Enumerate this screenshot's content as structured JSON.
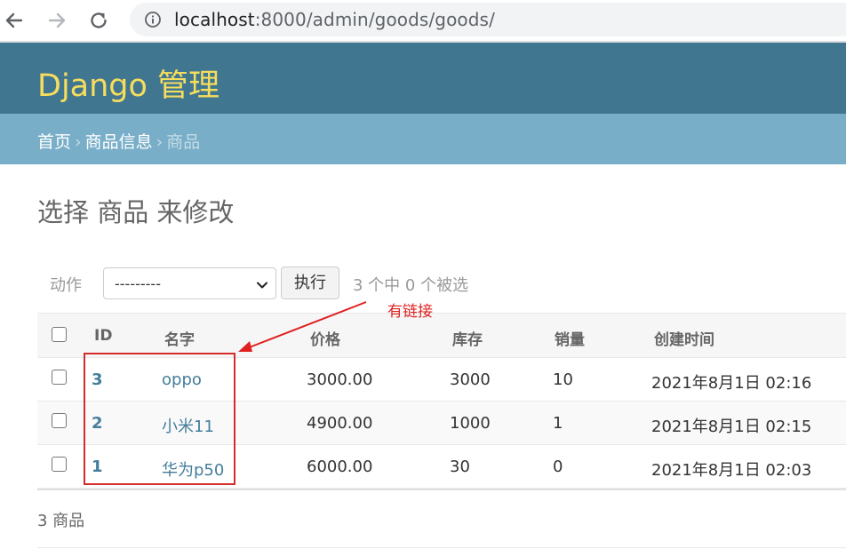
{
  "browser": {
    "url_host": "localhost",
    "url_rest": ":8000/admin/goods/goods/"
  },
  "header": {
    "branding": "Django 管理"
  },
  "breadcrumbs": {
    "home": "首页",
    "sep": "›",
    "app": "商品信息",
    "current": "商品"
  },
  "content": {
    "title": "选择 商品 来修改"
  },
  "actions": {
    "label": "动作",
    "selected": "---------",
    "go_button": "执行",
    "counter": "3 个中 0 个被选"
  },
  "annotation": {
    "text": "有链接"
  },
  "table": {
    "columns": [
      "ID",
      "名字",
      "价格",
      "库存",
      "销量",
      "创建时间"
    ],
    "rows": [
      {
        "id": "3",
        "name": "oppo",
        "price": "3000.00",
        "stock": "3000",
        "sales": "10",
        "created": "2021年8月1日 02:16"
      },
      {
        "id": "2",
        "name": "小米11",
        "price": "4900.00",
        "stock": "1000",
        "sales": "1",
        "created": "2021年8月1日 02:15"
      },
      {
        "id": "1",
        "name": "华为p50",
        "price": "6000.00",
        "stock": "30",
        "sales": "0",
        "created": "2021年8月1日 02:03"
      }
    ]
  },
  "paginator": {
    "text": "3 商品"
  },
  "colors": {
    "header_bg": "#417690",
    "branding": "#f5dd5d",
    "breadcrumbs_bg": "#79aec8",
    "link": "#447e9b",
    "annotation": "#d62b2b"
  }
}
